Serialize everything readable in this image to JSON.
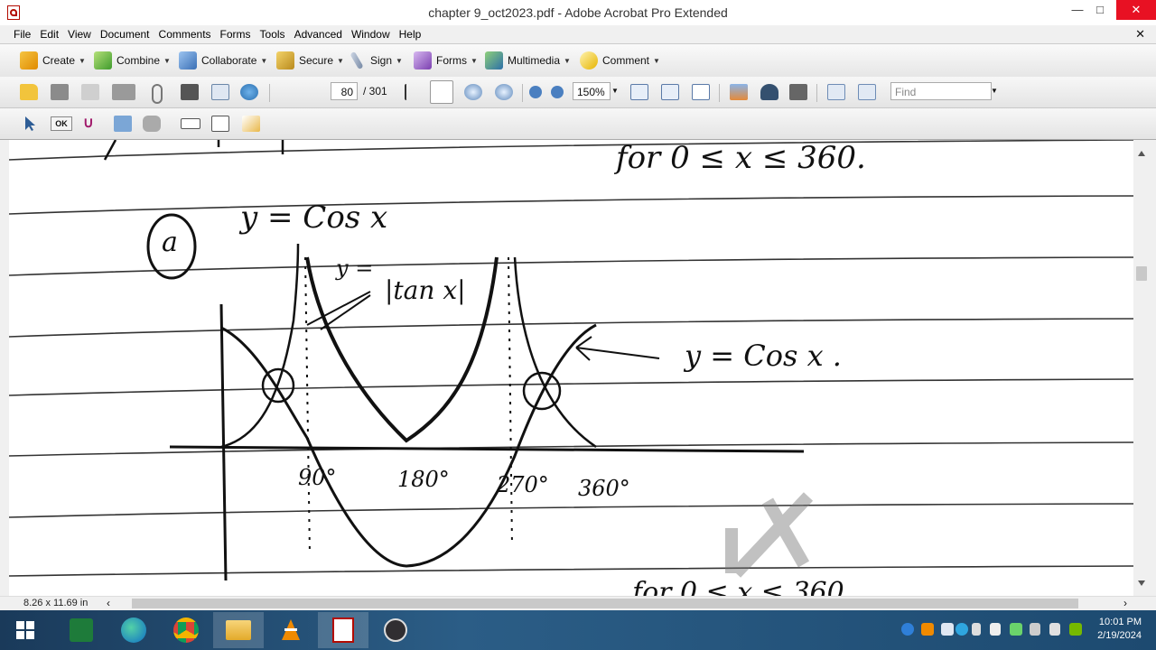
{
  "window": {
    "title": "chapter 9_oct2023.pdf - Adobe Acrobat Pro Extended",
    "minimize": "—",
    "maximize": "□",
    "close": "✕"
  },
  "menu": {
    "items": [
      "File",
      "Edit",
      "View",
      "Document",
      "Comments",
      "Forms",
      "Tools",
      "Advanced",
      "Window",
      "Help"
    ],
    "close": "✕"
  },
  "toolbar1": {
    "create": "Create",
    "combine": "Combine",
    "collaborate": "Collaborate",
    "secure": "Secure",
    "sign": "Sign",
    "forms": "Forms",
    "multimedia": "Multimedia",
    "comment": "Comment"
  },
  "toolbar2": {
    "page_current": "80",
    "page_total": "/ 301",
    "zoom": "150%",
    "find_placeholder": "Find"
  },
  "toolbar3": {
    "ok_label": "OK"
  },
  "document": {
    "top_text": "for 0 ≤ x ≤ 360.",
    "part_label": "a",
    "heading": "y = Cos x",
    "tan_label_1": "y =",
    "tan_label_2": "|tan x|",
    "cos_label": "y = Cos x .",
    "tick_90": "90°",
    "tick_180": "180°",
    "tick_270": "270°",
    "tick_360": "360°",
    "bottom_text": "for 0 ≤ x ≤ 360"
  },
  "status": {
    "page_size": "8.26 x 11.69 in"
  },
  "taskbar": {
    "time": "10:01 PM",
    "date": "2/19/2024"
  },
  "colors": {
    "close_red": "#e81123",
    "taskbar": "#2b5d86",
    "acrobat_red": "#b30b00"
  }
}
